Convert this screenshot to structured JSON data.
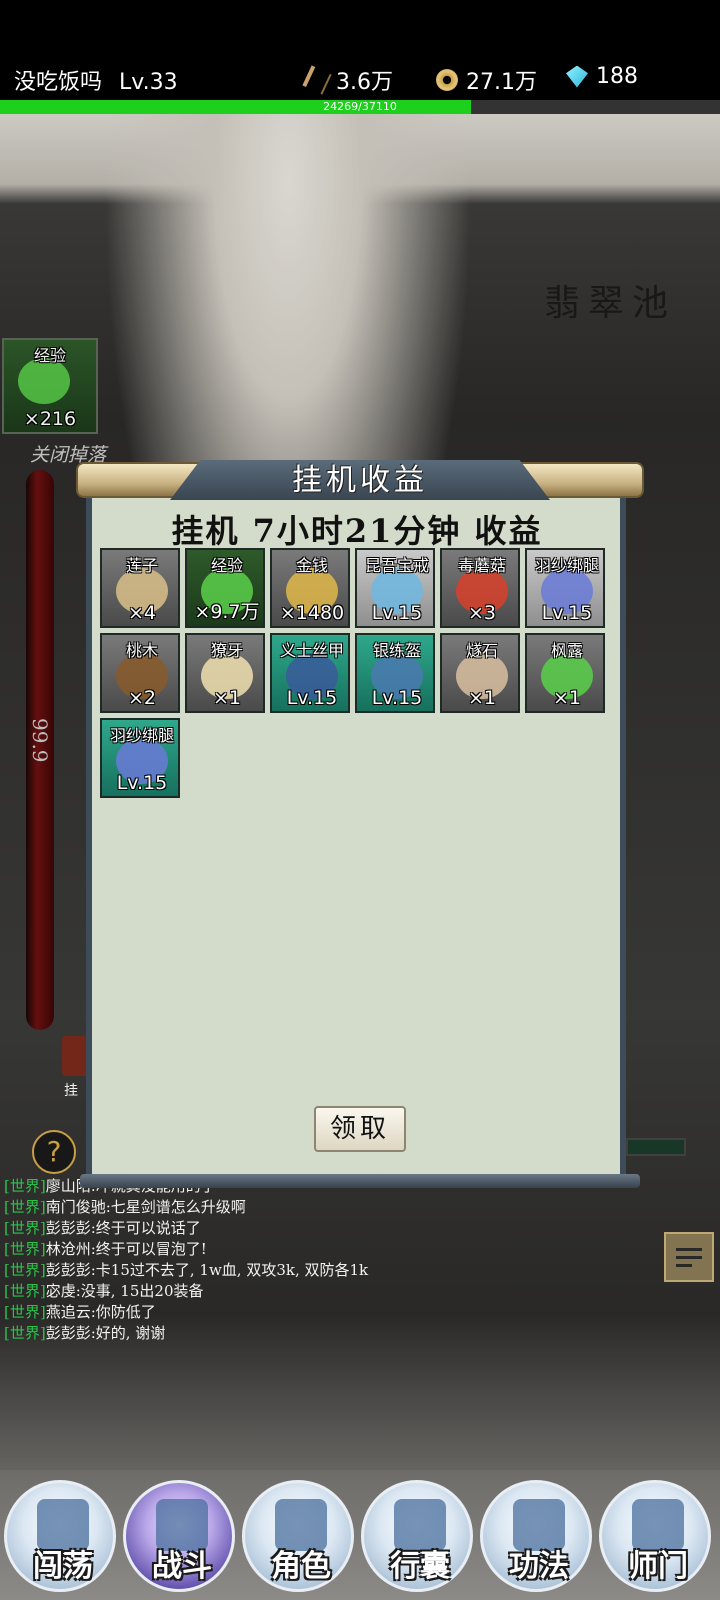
{
  "player": {
    "name": "没吃饭吗",
    "level": "Lv.33"
  },
  "resources": {
    "power": "3.6万",
    "coins": "27.1万",
    "gems": "188"
  },
  "exp": {
    "text": "24269/37110",
    "fraction": 0.654
  },
  "scene": {
    "location": "翡翠池"
  },
  "drop_panel": {
    "item_name": "经验",
    "item_count": "×216",
    "toggle_label": "关闭掉落"
  },
  "side_meter": {
    "value": "99.9"
  },
  "chest": {
    "label": "挂"
  },
  "help": {
    "icon": "?"
  },
  "chat": [
    {
      "channel": "[世界]",
      "text": "廖山阳:冲就其没能用的了"
    },
    {
      "channel": "[世界]",
      "text": "南门俊驰:七星剑谱怎么升级啊"
    },
    {
      "channel": "[世界]",
      "text": "彭彭彭:终于可以说话了"
    },
    {
      "channel": "[世界]",
      "text": "林沧州:终于可以冒泡了!"
    },
    {
      "channel": "[世界]",
      "text": "彭彭彭:卡15过不去了, 1w血, 双攻3k, 双防各1k"
    },
    {
      "channel": "[世界]",
      "text": "宓虔:没事, 15出20装备"
    },
    {
      "channel": "[世界]",
      "text": "燕追云:你防低了"
    },
    {
      "channel": "[世界]",
      "text": "彭彭彭:好的, 谢谢"
    }
  ],
  "modal": {
    "title": "挂机收益",
    "subtitle": "挂机 7小时21分钟 收益",
    "claim_label": "领取",
    "items": [
      {
        "name": "莲子",
        "count": "×4",
        "quality": "gray",
        "icon": "lotus-seed-icon",
        "color": "#d9c08a"
      },
      {
        "name": "经验",
        "count": "×9.7万",
        "quality": "green",
        "icon": "exp-icon",
        "color": "#5ad04a"
      },
      {
        "name": "金钱",
        "count": "×1480",
        "quality": "gray",
        "icon": "coin-icon",
        "color": "#e0b84a"
      },
      {
        "name": "昆吾宝戒",
        "count": "Lv.15",
        "quality": "light",
        "icon": "ring-icon",
        "color": "#6fb8e0"
      },
      {
        "name": "毒蘑菇",
        "count": "×3",
        "quality": "gray",
        "icon": "mushroom-icon",
        "color": "#d8402a"
      },
      {
        "name": "羽纱绑腿",
        "count": "Lv.15",
        "quality": "light",
        "icon": "leggings-icon",
        "color": "#6a7ad8"
      },
      {
        "name": "桃木",
        "count": "×2",
        "quality": "gray",
        "icon": "wood-icon",
        "color": "#8a5a2a"
      },
      {
        "name": "獠牙",
        "count": "×1",
        "quality": "gray",
        "icon": "fang-icon",
        "color": "#f0e0b0"
      },
      {
        "name": "义士丝甲",
        "count": "Lv.15",
        "quality": "teal",
        "icon": "armor-icon",
        "color": "#3a5a9a"
      },
      {
        "name": "银练盔",
        "count": "Lv.15",
        "quality": "teal",
        "icon": "helmet-icon",
        "color": "#4a7ab0"
      },
      {
        "name": "燧石",
        "count": "×1",
        "quality": "gray",
        "icon": "flint-icon",
        "color": "#d8c0a0"
      },
      {
        "name": "枫露",
        "count": "×1",
        "quality": "gray",
        "icon": "leaf-icon",
        "color": "#5ad04a"
      },
      {
        "name": "羽纱绑腿",
        "count": "Lv.15",
        "quality": "teal",
        "icon": "leggings-icon",
        "color": "#6a7ad8"
      }
    ]
  },
  "nav": [
    {
      "label": "闯荡",
      "icon": "map-scroll-icon",
      "active": false
    },
    {
      "label": "战斗",
      "icon": "crossed-swords-icon",
      "active": true
    },
    {
      "label": "角色",
      "icon": "character-icon",
      "active": false
    },
    {
      "label": "行囊",
      "icon": "bag-icon",
      "active": false
    },
    {
      "label": "功法",
      "icon": "manual-scroll-icon",
      "active": false
    },
    {
      "label": "师门",
      "icon": "sect-building-icon",
      "active": false
    }
  ]
}
